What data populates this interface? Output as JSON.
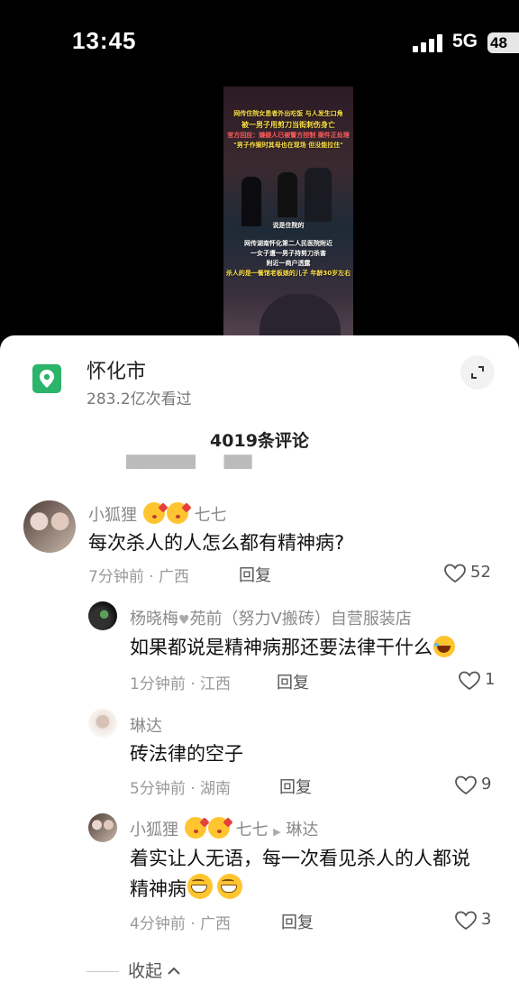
{
  "status_bar": {
    "time": "13:45",
    "network": "5G",
    "battery": "48"
  },
  "video": {
    "captions": [
      "网传住院女患者外出吃饭 与人发生口角",
      "被一男子用剪刀当街刺伤身亡",
      "官方回应：嫌疑人已被警方控制 案件正处理",
      "\"男子作案时其母也在现场 但没能拉住\"",
      "说是住院的",
      "网传湖南怀化第二人民医院附近",
      "一女子遭一男子持剪刀杀害",
      "附近一商户透露",
      "杀人的是一餐馆老板娘的儿子 年龄30岁左右"
    ]
  },
  "location": {
    "name": "怀化市",
    "views": "283.2亿次看过"
  },
  "comment_count_label": "4019条评论",
  "comments": [
    {
      "user": "小狐狸",
      "user_suffix": "七七",
      "text": "每次杀人的人怎么都有精神病?",
      "meta": "7分钟前 · 广西",
      "reply_label": "回复",
      "likes": "52"
    }
  ],
  "replies": [
    {
      "user_a": "杨晓梅",
      "user_b": "苑前（努力V搬砖）自营服装店",
      "text": "如果都说是精神病那还要法律干什么",
      "meta": "1分钟前 · 江西",
      "reply_label": "回复",
      "likes": "1"
    },
    {
      "user": "琳达",
      "text": "砖法律的空子",
      "meta": "5分钟前 · 湖南",
      "reply_label": "回复",
      "likes": "9"
    },
    {
      "user": "小狐狸",
      "user_mid": "七七",
      "reply_to": "琳达",
      "text_line1": "着实让人无语，每一次看见杀人的人都说",
      "text_line2": "精神病",
      "meta": "4分钟前 · 广西",
      "reply_label": "回复",
      "likes": "3"
    }
  ],
  "collapse_label": "收起",
  "icons": {
    "location": "map-pin-icon",
    "expand": "expand-icon",
    "like": "heart-outline-icon",
    "collapse": "chevron-up-icon"
  },
  "colors": {
    "accent_green": "#2bb46a",
    "sheet_bg": "#ffffff",
    "muted_text": "#999999"
  }
}
